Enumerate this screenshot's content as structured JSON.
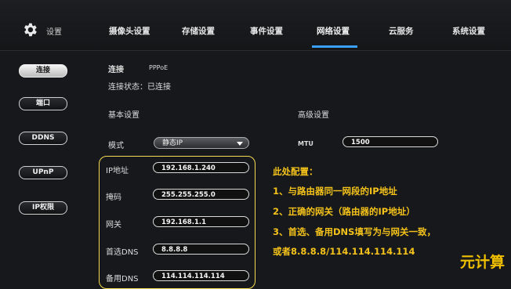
{
  "header": {
    "settings_label": "设置",
    "tabs": [
      {
        "label": "摄像头设置"
      },
      {
        "label": "存储设置"
      },
      {
        "label": "事件设置"
      },
      {
        "label": "网络设置"
      },
      {
        "label": "云服务"
      },
      {
        "label": "系统设置"
      }
    ]
  },
  "sidebar": {
    "items": [
      {
        "label": "连接"
      },
      {
        "label": "端口"
      },
      {
        "label": "DDNS"
      },
      {
        "label": "UPnP"
      },
      {
        "label": "IP权限"
      }
    ]
  },
  "main": {
    "connection_tab": "连接",
    "pppoe_tab": "PPPoE",
    "status": "连接状态：已连接",
    "basic_settings": "基本设置",
    "advanced_settings": "高级设置",
    "mode_label": "模式",
    "mode_value": "静态IP",
    "mtu_label": "MTU",
    "mtu_value": "1500",
    "fields": [
      {
        "label": "IP地址",
        "value": "192.168.1.240"
      },
      {
        "label": "掩码",
        "value": "255.255.255.0"
      },
      {
        "label": "网关",
        "value": "192.168.1.1"
      },
      {
        "label": "首选DNS",
        "value": "8.8.8.8"
      },
      {
        "label": "备用DNS",
        "value": "114.114.114.114"
      }
    ]
  },
  "annotation": {
    "lines": [
      "此处配置：",
      "1、与路由器同一网段的IP地址",
      "2、正确的网关（路由器的IP地址）",
      "3、首选、备用DNS填写为与网关一致，",
      "或者8.8.8.8/114.114.114.114"
    ],
    "color": "#f4c21b"
  },
  "watermark": "元计算",
  "colors": {
    "accent": "#3aa0ff",
    "highlight_border": "#f3dc55"
  }
}
